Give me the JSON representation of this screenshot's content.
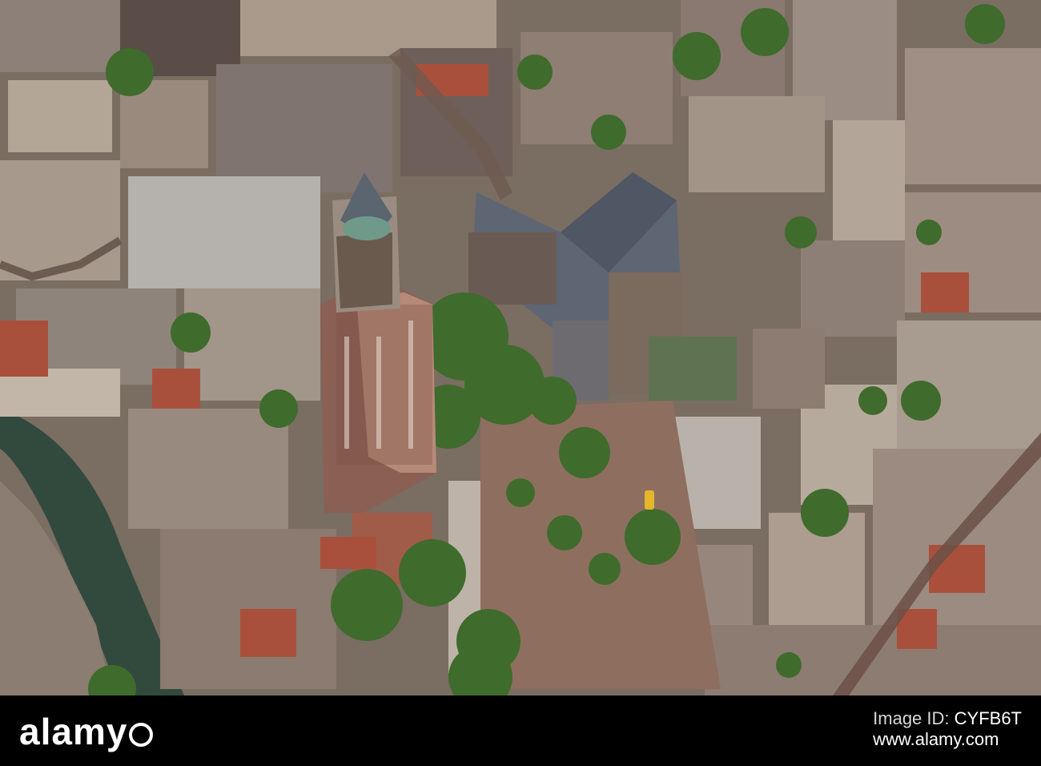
{
  "footer": {
    "brand": "alamy",
    "image_id_label": "Image ID:",
    "image_id": "CYFB6T",
    "site": "www.alamy.com"
  }
}
